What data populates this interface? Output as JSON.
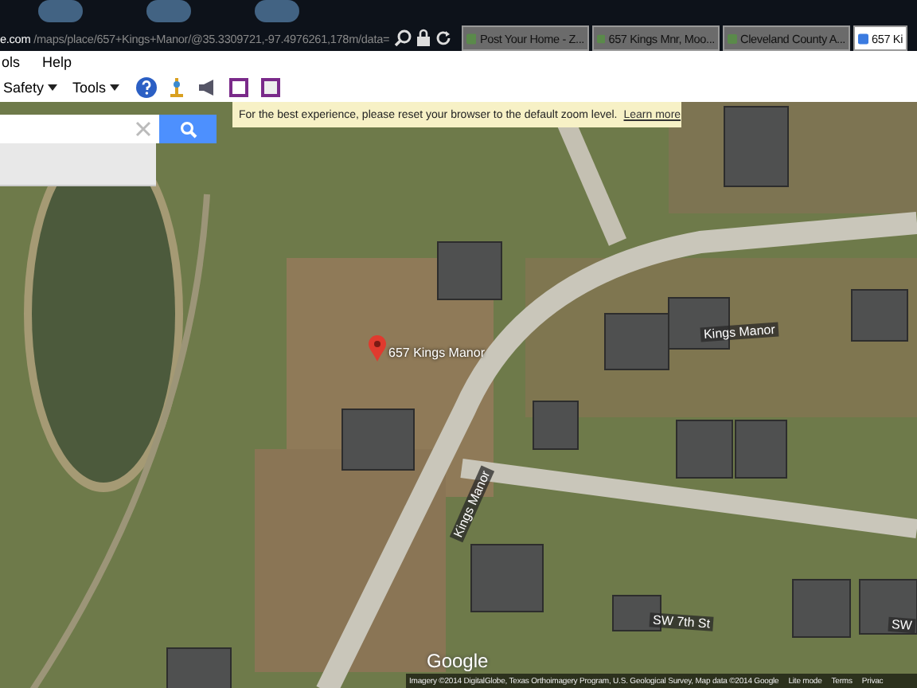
{
  "browser": {
    "address": {
      "host": "e.com",
      "path": "/maps/place/657+Kings+Manor/@35.3309721,-97.4976261,178m/data="
    },
    "tabs": [
      {
        "title": "Post Your Home - Z...",
        "selected": false
      },
      {
        "title": "657 Kings Mnr, Moo...",
        "selected": false
      },
      {
        "title": "Cleveland County A...",
        "selected": false
      },
      {
        "title": "657 Ki",
        "selected": true
      }
    ],
    "menu": [
      "ols",
      "Help"
    ],
    "toolbar": [
      "Safety",
      "Tools"
    ]
  },
  "map": {
    "notice": {
      "text": "For the best experience, please reset your browser to the default zoom level.",
      "link": "Learn more"
    },
    "pin_label": "657 Kings Manor",
    "streets": [
      "Kings Manor",
      "Kings Manor",
      "SW 7th St",
      "SW"
    ],
    "logo": "Google",
    "footer": {
      "attribution": "Imagery ©2014 DigitalGlobe, Texas Orthoimagery Program, U.S. Geological Survey, Map data ©2014 Google",
      "links": [
        "Lite mode",
        "Terms",
        "Privac"
      ]
    }
  }
}
